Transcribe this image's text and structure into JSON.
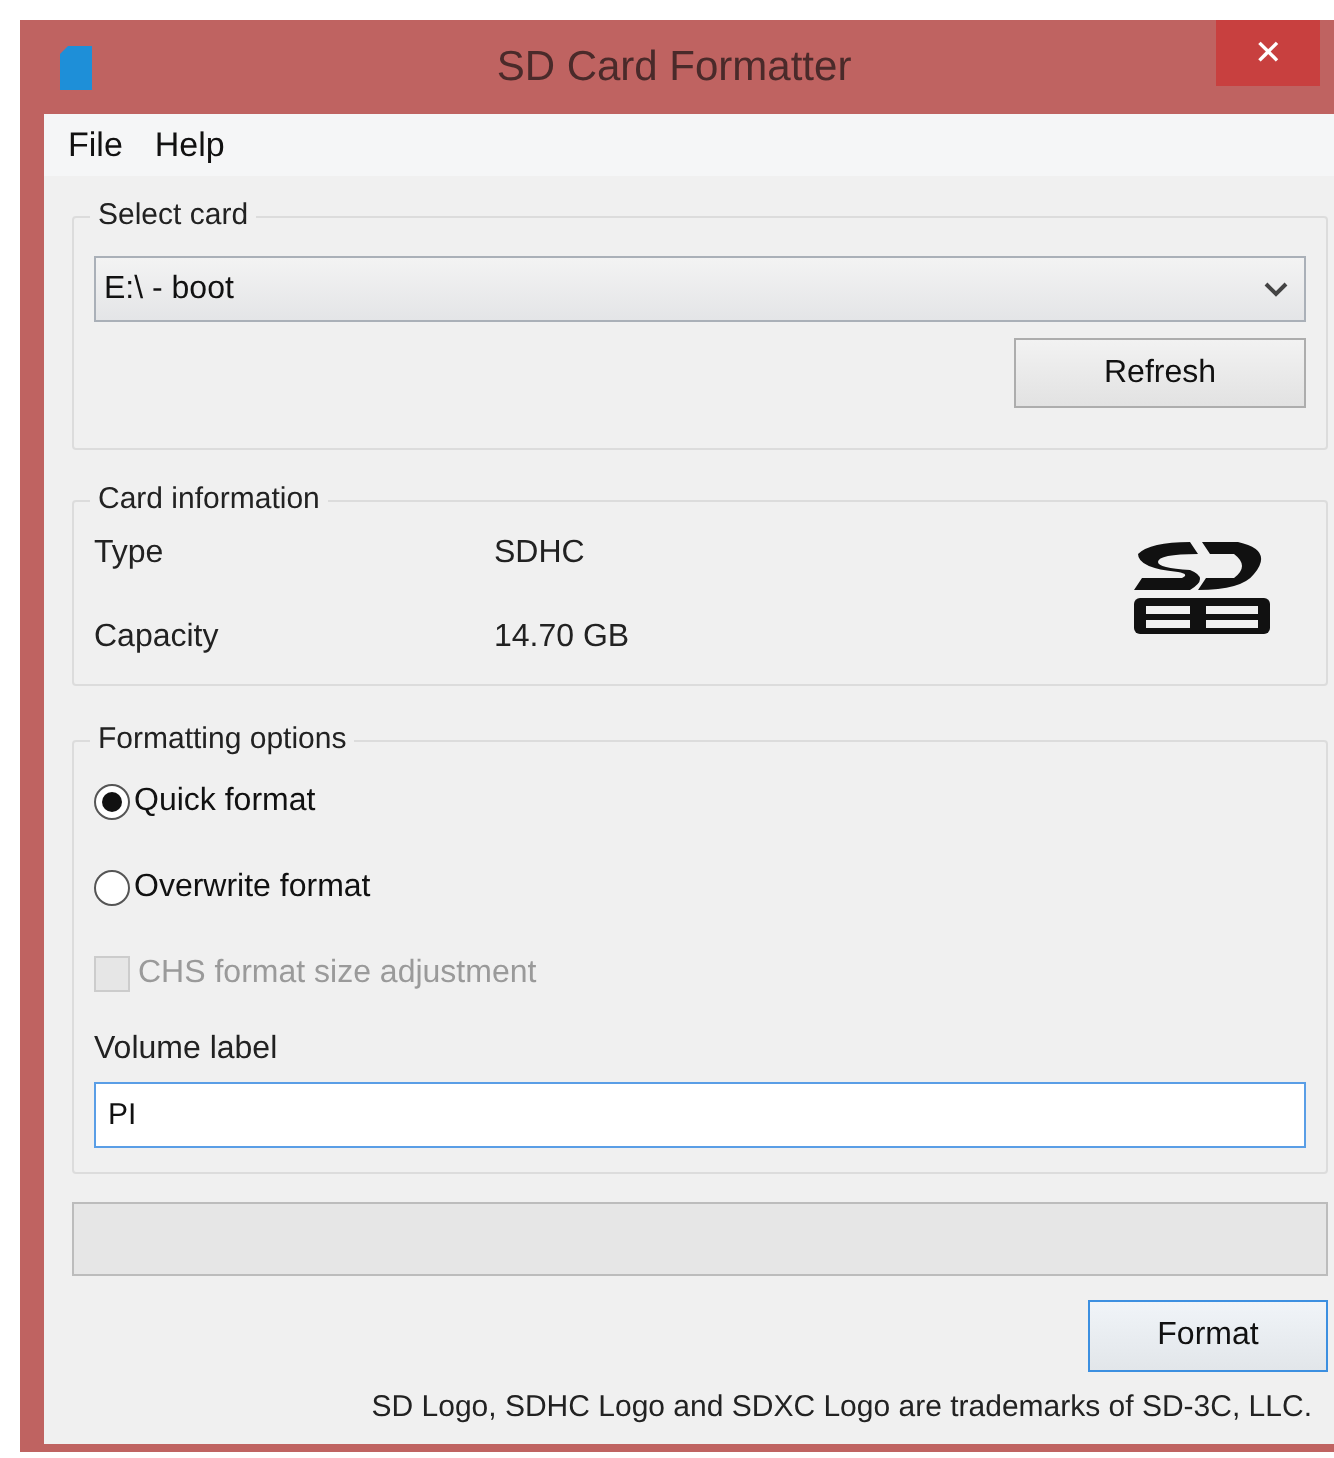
{
  "window": {
    "title": "SD Card Formatter",
    "close": "✕"
  },
  "menu": [
    {
      "label": "File"
    },
    {
      "label": "Help"
    }
  ],
  "select_card": {
    "title": "Select card",
    "value": "E:\\ - boot",
    "refresh": "Refresh"
  },
  "card_information": {
    "title": "Card information",
    "rows": [
      {
        "label": "Type",
        "value": "SDHC"
      },
      {
        "label": "Capacity",
        "value": "14.70 GB"
      }
    ]
  },
  "formatting_options": {
    "title": "Formatting options",
    "options": [
      {
        "label": "Quick format",
        "selected": true
      },
      {
        "label": "Overwrite format",
        "selected": false
      }
    ],
    "chs": {
      "label": "CHS format size adjustment",
      "checked": false,
      "disabled": true
    },
    "volume_label": {
      "label": "Volume label",
      "value": "PI"
    }
  },
  "progress": {
    "level": 0
  },
  "format_button": "Format",
  "footer": "SD Logo, SDHC Logo and SDXC Logo are trademarks of SD-3C, LLC."
}
